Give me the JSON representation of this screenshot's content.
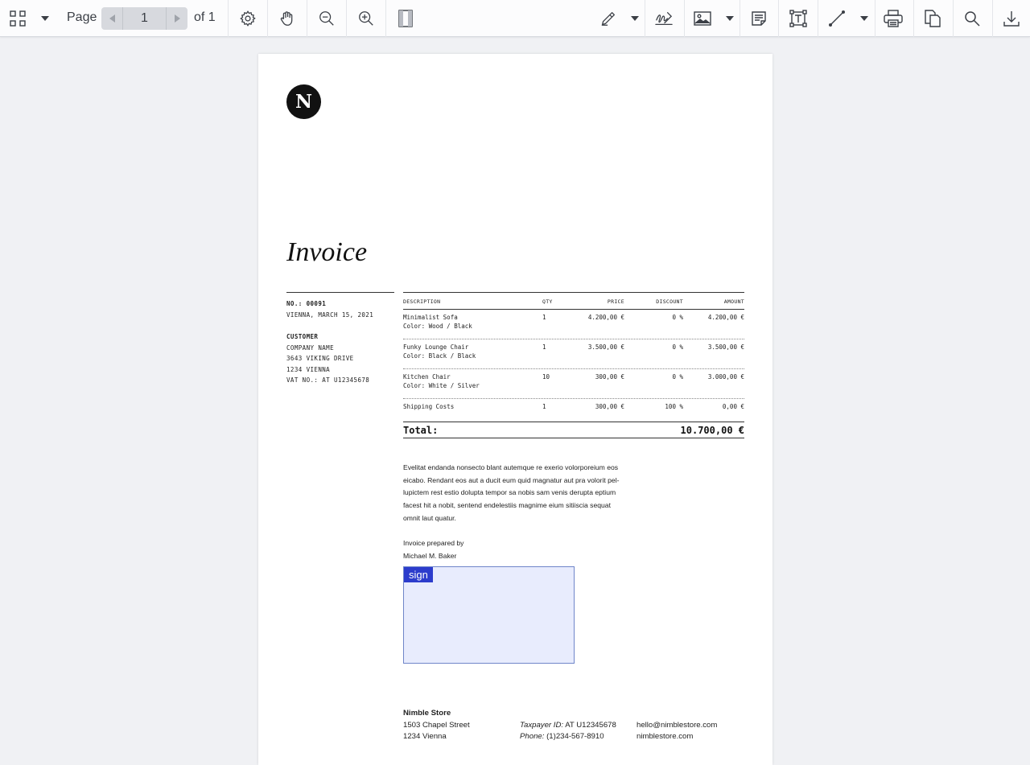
{
  "toolbar": {
    "page_label": "Page",
    "current_page": "1",
    "of_label": "of 1",
    "icons": [
      "grid-icon",
      "chevron-down-icon",
      "gear-icon",
      "hand-icon",
      "zoom-out-icon",
      "zoom-in-icon",
      "panel-icon",
      "highlighter-icon",
      "signature-icon",
      "image-icon",
      "note-icon",
      "text-box-icon",
      "line-icon",
      "print-icon",
      "copy-icon",
      "search-icon",
      "download-icon"
    ]
  },
  "document": {
    "logo_letter": "N",
    "title": "Invoice",
    "meta": {
      "number": "NO.: 00091",
      "date": "VIENNA, MARCH 15, 2021",
      "customer_label": "CUSTOMER",
      "company": "COMPANY NAME",
      "street": "3643 VIKING DRIVE",
      "city": "1234 VIENNA",
      "vat": "VAT NO.: AT U12345678"
    },
    "table": {
      "headers": {
        "description": "DESCRIPTION",
        "qty": "QTY",
        "price": "PRICE",
        "discount": "DISCOUNT",
        "amount": "AMOUNT"
      },
      "rows": [
        {
          "name": "Minimalist Sofa",
          "variant": "Color: Wood / Black",
          "qty": "1",
          "price": "4.200,00 €",
          "discount": "0 %",
          "amount": "4.200,00 €"
        },
        {
          "name": "Funky Lounge Chair",
          "variant": "Color: Black / Black",
          "qty": "1",
          "price": "3.500,00 €",
          "discount": "0 %",
          "amount": "3.500,00 €"
        },
        {
          "name": "Kitchen Chair",
          "variant": "Color: White / Silver",
          "qty": "10",
          "price": "300,00 €",
          "discount": "0 %",
          "amount": "3.000,00 €"
        },
        {
          "name": "Shipping Costs",
          "variant": "",
          "qty": "1",
          "price": "300,00 €",
          "discount": "100 %",
          "amount": "0,00 €"
        }
      ]
    },
    "total_label": "Total:",
    "total_value": "10.700,00 €",
    "body_lines": [
      "Evelitat endanda nonsecto blant autemque re exerio volorporeium eos",
      "eicabo. Rendant eos aut a ducit eum quid magnatur aut pra volorit pel-",
      "lupictem rest estio dolupta tempor sa nobis sam venis derupta eptium",
      "facest hit a nobit, sentend endelestiis magnime eium sitiiscia sequat",
      "omnit laut quatur."
    ],
    "prepared_by_label": "Invoice prepared by",
    "prepared_by_name": "Michael M. Baker",
    "sign_label": "sign",
    "footer": {
      "store_name": "Nimble Store",
      "street": "1503 Chapel Street",
      "city": "1234 Vienna",
      "tax_label": "Taxpayer ID:",
      "tax_value": "AT U12345678",
      "phone_label": "Phone:",
      "phone_value": "(1)234-567-8910",
      "email": "hello@nimblestore.com",
      "website": "nimblestore.com"
    }
  }
}
